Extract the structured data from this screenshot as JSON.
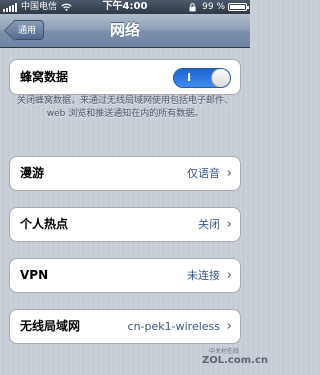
{
  "status_bar": {
    "carrier": "中国电信",
    "time": "下午4:00",
    "battery_percent": "99 %",
    "battery_level": 0.99
  },
  "nav": {
    "back_label": "通用",
    "title": "网络"
  },
  "cellular": {
    "label": "蜂窝数据",
    "toggle_text": "I",
    "enabled": true,
    "footnote": "关闭蜂窝数据，来通过无线局域网使用包括电子邮件、web 浏览和推送通知在内的所有数据。"
  },
  "roaming": {
    "label": "漫游",
    "value": "仅语音"
  },
  "hotspot": {
    "label": "个人热点",
    "value": "关闭"
  },
  "vpn": {
    "label": "VPN",
    "value": "未连接"
  },
  "wifi": {
    "label": "无线局域网",
    "value": "cn-pek1-wireless"
  },
  "watermark": {
    "line1": "中关村在线",
    "line2": "ZOL.com.cn"
  },
  "colors": {
    "value_text": "#385487",
    "toggle_on": "#2f7ae5",
    "background": "#c5ccd4"
  }
}
